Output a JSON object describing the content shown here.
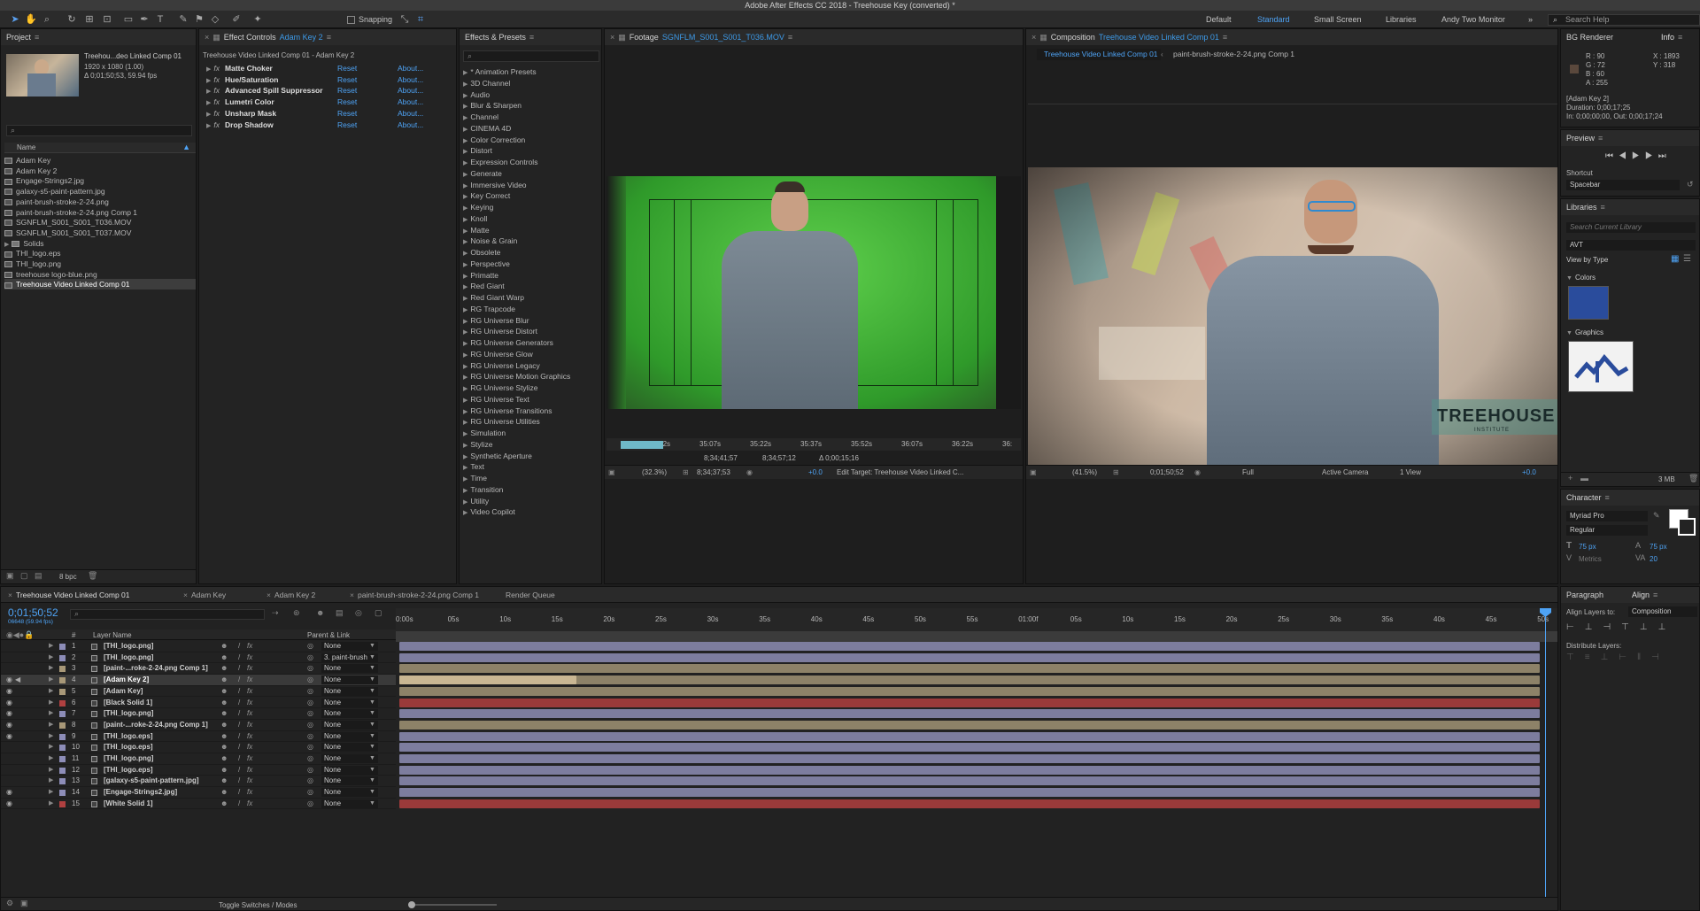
{
  "app": {
    "title": "Adobe After Effects CC 2018 - Treehouse Key (converted) *"
  },
  "toolbar": {
    "snapping": "Snapping",
    "workspaces": [
      "Default",
      "Standard",
      "Small Screen",
      "Libraries",
      "Andy Two Monitor"
    ],
    "active_workspace": "Standard",
    "search_help": "Search Help"
  },
  "project": {
    "title": "Project",
    "comp_name": "Treehou...deo Linked Comp 01",
    "comp_res": "1920 x 1080 (1.00)",
    "comp_dur": "Δ 0;01;50;53, 59.94 fps",
    "name_header": "Name",
    "bpc": "8 bpc",
    "items": [
      {
        "name": "Adam Key",
        "type": "comp"
      },
      {
        "name": "Adam Key 2",
        "type": "comp"
      },
      {
        "name": "Engage-Strings2.jpg",
        "type": "file"
      },
      {
        "name": "galaxy-s5-paint-pattern.jpg",
        "type": "file"
      },
      {
        "name": "paint-brush-stroke-2-24.png",
        "type": "file"
      },
      {
        "name": "paint-brush-stroke-2-24.png Comp 1",
        "type": "comp"
      },
      {
        "name": "SGNFLM_S001_S001_T036.MOV",
        "type": "comp"
      },
      {
        "name": "SGNFLM_S001_S001_T037.MOV",
        "type": "comp"
      },
      {
        "name": "Solids",
        "type": "folder"
      },
      {
        "name": "THI_logo.eps",
        "type": "file"
      },
      {
        "name": "THI_logo.png",
        "type": "file"
      },
      {
        "name": "treehouse logo-blue.png",
        "type": "file"
      },
      {
        "name": "Treehouse Video Linked Comp 01",
        "type": "comp"
      }
    ]
  },
  "effect_controls": {
    "title_prefix": "Effect Controls",
    "title_layer": "Adam Key 2",
    "subtitle": "Treehouse Video Linked Comp 01 - Adam Key 2",
    "reset": "Reset",
    "about": "About...",
    "effects": [
      "Matte Choker",
      "Hue/Saturation",
      "Advanced Spill Suppressor",
      "Lumetri Color",
      "Unsharp Mask",
      "Drop Shadow"
    ]
  },
  "effects_presets": {
    "title": "Effects & Presets",
    "items": [
      "* Animation Presets",
      "3D Channel",
      "Audio",
      "Blur & Sharpen",
      "Channel",
      "CINEMA 4D",
      "Color Correction",
      "Distort",
      "Expression Controls",
      "Generate",
      "Immersive Video",
      "Key Correct",
      "Keying",
      "Knoll",
      "Matte",
      "Noise & Grain",
      "Obsolete",
      "Perspective",
      "Primatte",
      "Red Giant",
      "Red Giant Warp",
      "RG Trapcode",
      "RG Universe Blur",
      "RG Universe Distort",
      "RG Universe Generators",
      "RG Universe Glow",
      "RG Universe Legacy",
      "RG Universe Motion Graphics",
      "RG Universe Stylize",
      "RG Universe Text",
      "RG Universe Transitions",
      "RG Universe Utilities",
      "Simulation",
      "Stylize",
      "Synthetic Aperture",
      "Text",
      "Time",
      "Transition",
      "Utility",
      "Video Copilot"
    ]
  },
  "footage": {
    "title_prefix": "Footage",
    "title_file": "SGNFLM_S001_S001_T036.MOV",
    "ruler": [
      "34:52s",
      "35:07s",
      "35:22s",
      "35:37s",
      "35:52s",
      "36:07s",
      "36:22s",
      "36:"
    ],
    "in_point": "8;34;41;57",
    "out_point": "8;34;57;12",
    "duration": "Δ 0;00;15;16",
    "zoom": "(32.3%)",
    "timecode": "8;34;37;53",
    "offset": "+0.0",
    "edit_target": "Edit Target: Treehouse Video Linked C..."
  },
  "composition": {
    "title_prefix": "Composition",
    "title_comp": "Treehouse Video Linked Comp 01",
    "tabs": [
      "Treehouse Video Linked Comp 01",
      "paint-brush-stroke-2-24.png Comp 1"
    ],
    "zoom": "(41.5%)",
    "timecode": "0;01;50;52",
    "resolution": "Full",
    "camera": "Active Camera",
    "views": "1 View",
    "offset": "+0.0",
    "logo_text": "TREEHOUSE",
    "logo_sub": "INSTITUTE"
  },
  "info": {
    "tabs": [
      "BG Renderer",
      "Info"
    ],
    "r": "R : 90",
    "g": "G : 72",
    "b": "B : 60",
    "a": "A : 255",
    "x": "X : 1893",
    "y": "Y : 318",
    "layer": "[Adam Key 2]",
    "duration": "Duration: 0;00;17;25",
    "inout": "In: 0;00;00;00, Out: 0;00;17;24",
    "swatch": "#5a483c"
  },
  "preview": {
    "title": "Preview",
    "shortcut_label": "Shortcut",
    "shortcut": "Spacebar"
  },
  "libraries": {
    "title": "Libraries",
    "search_placeholder": "Search Current Library",
    "library": "AVT",
    "view_by": "View by Type",
    "colors_label": "Colors",
    "graphics_label": "Graphics",
    "size": "3 MB",
    "color_swatch": "#2a4c9c"
  },
  "character": {
    "title": "Character",
    "font": "Myriad Pro",
    "style": "Regular",
    "size": "75 px",
    "leading": "75 px",
    "metrics": "Metrics",
    "tracking": "20"
  },
  "align": {
    "tabs": [
      "Paragraph",
      "Align"
    ],
    "align_to_label": "Align Layers to:",
    "align_to": "Composition",
    "distribute": "Distribute Layers:"
  },
  "timeline": {
    "tabs": [
      "Treehouse Video Linked Comp 01",
      "Adam Key",
      "Adam Key 2",
      "paint-brush-stroke-2-24.png Comp 1",
      "Render Queue"
    ],
    "timecode": "0;01;50;52",
    "frames": "06648 (59.94 fps)",
    "layer_name_header": "Layer Name",
    "parent_header": "Parent & Link",
    "toggle": "Toggle Switches / Modes",
    "ruler": [
      "0:00s",
      "05s",
      "10s",
      "15s",
      "20s",
      "25s",
      "30s",
      "35s",
      "40s",
      "45s",
      "50s",
      "55s",
      "01:00f",
      "05s",
      "10s",
      "15s",
      "20s",
      "25s",
      "30s",
      "35s",
      "40s",
      "45s",
      "50s"
    ],
    "layers": [
      {
        "num": "1",
        "name": "[THI_logo.png]",
        "parent": "None",
        "color": "#8d8db8",
        "bar": "#7d7d9e"
      },
      {
        "num": "2",
        "name": "[THI_logo.png]",
        "parent": "3. paint-brush",
        "color": "#8d8db8",
        "bar": "#7d7d9e"
      },
      {
        "num": "3",
        "name": "[paint-...roke-2-24.png Comp 1]",
        "parent": "None",
        "color": "#a89878",
        "bar": "#8d8268"
      },
      {
        "num": "4",
        "name": "[Adam Key 2]",
        "parent": "None",
        "color": "#a89878",
        "bar": "#8d8268"
      },
      {
        "num": "5",
        "name": "[Adam Key]",
        "parent": "None",
        "color": "#a89878",
        "bar": "#8d8268"
      },
      {
        "num": "6",
        "name": "[Black Solid 1]",
        "parent": "None",
        "color": "#b04040",
        "bar": "#9a3a3a"
      },
      {
        "num": "7",
        "name": "[THI_logo.png]",
        "parent": "None",
        "color": "#8d8db8",
        "bar": "#7d7d9e"
      },
      {
        "num": "8",
        "name": "[paint-...roke-2-24.png Comp 1]",
        "parent": "None",
        "color": "#a89878",
        "bar": "#8d8268"
      },
      {
        "num": "9",
        "name": "[THI_logo.eps]",
        "parent": "None",
        "color": "#8d8db8",
        "bar": "#7d7d9e"
      },
      {
        "num": "10",
        "name": "[THI_logo.eps]",
        "parent": "None",
        "color": "#8d8db8",
        "bar": "#7d7d9e"
      },
      {
        "num": "11",
        "name": "[THI_logo.png]",
        "parent": "None",
        "color": "#8d8db8",
        "bar": "#7d7d9e"
      },
      {
        "num": "12",
        "name": "[THI_logo.eps]",
        "parent": "None",
        "color": "#8d8db8",
        "bar": "#7d7d9e"
      },
      {
        "num": "13",
        "name": "[galaxy-s5-paint-pattern.jpg]",
        "parent": "None",
        "color": "#8d8db8",
        "bar": "#7d7d9e"
      },
      {
        "num": "14",
        "name": "[Engage-Strings2.jpg]",
        "parent": "None",
        "color": "#8d8db8",
        "bar": "#7d7d9e"
      },
      {
        "num": "15",
        "name": "[White Solid 1]",
        "parent": "None",
        "color": "#b04040",
        "bar": "#9a3a3a"
      }
    ]
  }
}
